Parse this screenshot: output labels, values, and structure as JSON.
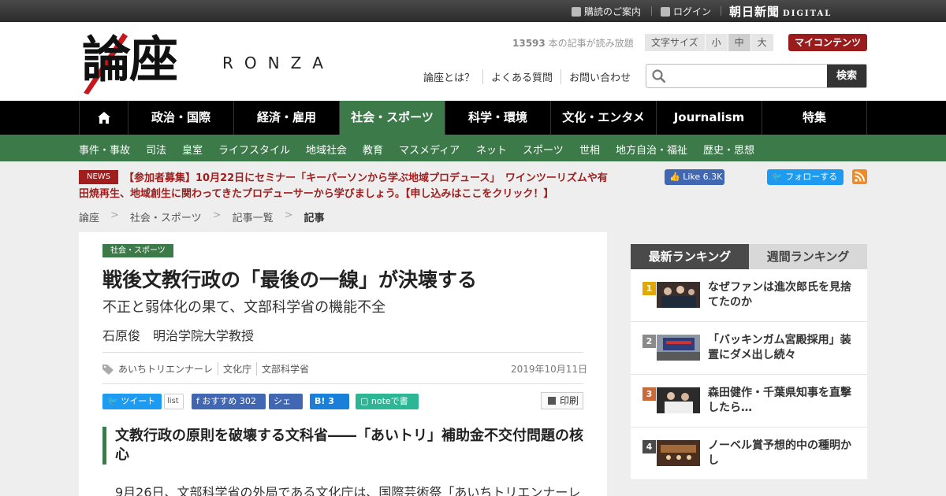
{
  "topbar": {
    "subscribe": "購読のご案内",
    "login": "ログイン",
    "brand": "朝日新聞",
    "brand_sub": "DIGITAL"
  },
  "header": {
    "logo": "論座",
    "logo_sub": "RONZA",
    "read_count": "13593",
    "read_count_suffix": " 本の記事が読み放題",
    "font_size_label": "文字サイズ",
    "font_sizes": [
      "小",
      "中",
      "大"
    ],
    "my_contents": "マイコンテンツ",
    "links": [
      "論座とは？",
      "よくある質問",
      "お問い合わせ"
    ],
    "search_placeholder": "",
    "search_button": "検索"
  },
  "nav": {
    "tabs": [
      "政治・国際",
      "経済・雇用",
      "社会・スポーツ",
      "科学・環境",
      "文化・エンタメ",
      "Journalism",
      "特集"
    ],
    "active": "社会・スポーツ"
  },
  "subnav": [
    "事件・事故",
    "司法",
    "皇室",
    "ライフスタイル",
    "地域社会",
    "教育",
    "マスメディア",
    "ネット",
    "スポーツ",
    "世相",
    "地方自治・福祉",
    "歴史・思想"
  ],
  "news": {
    "badge": "NEWS",
    "text": "【参加者募集】10月22日にセミナー「キーパーソンから学ぶ地域プロデュース」　ワインツーリズムや有田焼再生、地域創生に関わってきたプロデューサーから学びましょう。【申し込みはここをクリック！】"
  },
  "social": {
    "fb_like": "Like 6.3K",
    "tw_follow": "フォローする"
  },
  "breadcrumb": [
    "論座",
    "社会・スポーツ",
    "記事一覧",
    "記事"
  ],
  "article": {
    "category": "社会・スポーツ",
    "title": "戦後文教行政の「最後の一線」が決壊する",
    "subtitle": "不正と弱体化の果て、文部科学省の機能不全",
    "author": "石原俊　明治学院大学教授",
    "tags": [
      "あいちトリエンナーレ",
      "文化庁",
      "文部科学省"
    ],
    "date": "2019年10月11日",
    "share": {
      "tweet": "ツイート",
      "list": "list",
      "fb_recommend": "おすすめ 302",
      "fb_share": "シェア",
      "hatena_count": "3",
      "note": "noteで書く",
      "print": "印刷"
    },
    "section_head": "文教行政の原則を破壊する文科省――「あいトリ」補助金不交付問題の核心",
    "body_start": "9月26日、文部科学省の外局である文化庁は、国際芸術祭「あいちトリエンナーレ"
  },
  "ranking": {
    "tabs": [
      "最新ランキング",
      "週間ランキング"
    ],
    "items": [
      {
        "num": "1",
        "title": "なぜファンは進次郎氏を見捨てたのか",
        "color": "#e0a800"
      },
      {
        "num": "2",
        "title": "「バッキンガム宮殿採用」装置にダメ出し続々",
        "color": "#8a8a8a"
      },
      {
        "num": "3",
        "title": "森田健作・千葉県知事を直撃したら…",
        "color": "#c96a3b"
      },
      {
        "num": "4",
        "title": "ノーベル賞予想的中の種明かし",
        "color": "#4a4a4a"
      }
    ]
  },
  "colors": {
    "green": "#3d7a4a",
    "red": "#a01e1e",
    "dark": "#000000"
  }
}
